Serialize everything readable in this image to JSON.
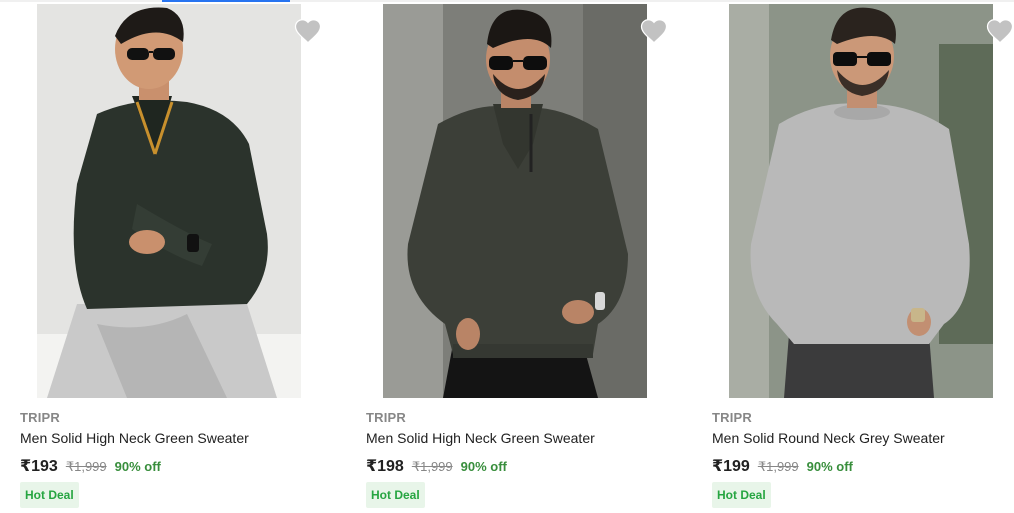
{
  "colors": {
    "brand_text": "#878787",
    "title_text": "#212121",
    "discount": "#388e3c",
    "deal_text": "#26a541",
    "deal_bg": "#e8f5e9",
    "wishlist_icon": "#c2c2c2",
    "active_tab": "#2874f0"
  },
  "products": [
    {
      "brand": "TRIPR",
      "title": "Men Solid High Neck Green Sweater",
      "price": "₹193",
      "mrp": "₹1,999",
      "discount": "90% off",
      "badge": "Hot Deal",
      "wishlist_icon": "heart-icon",
      "image": {
        "sweater_color": "#2b332c",
        "background": "#e6e6e6",
        "description": "man in dark green high neck zip sweater"
      }
    },
    {
      "brand": "TRIPR",
      "title": "Men Solid High Neck Green Sweater",
      "price": "₹198",
      "mrp": "₹1,999",
      "discount": "90% off",
      "badge": "Hot Deal",
      "wishlist_icon": "heart-icon",
      "image": {
        "sweater_color": "#3c3f38",
        "background": "#7b7c78",
        "description": "man in olive high neck sweater"
      }
    },
    {
      "brand": "TRIPR",
      "title": "Men Solid Round Neck Grey Sweater",
      "price": "₹199",
      "mrp": "₹1,999",
      "discount": "90% off",
      "badge": "Hot Deal",
      "wishlist_icon": "heart-icon",
      "image": {
        "sweater_color": "#b9b9b9",
        "background": "#8e958a",
        "description": "man in grey round neck sweater"
      }
    }
  ]
}
